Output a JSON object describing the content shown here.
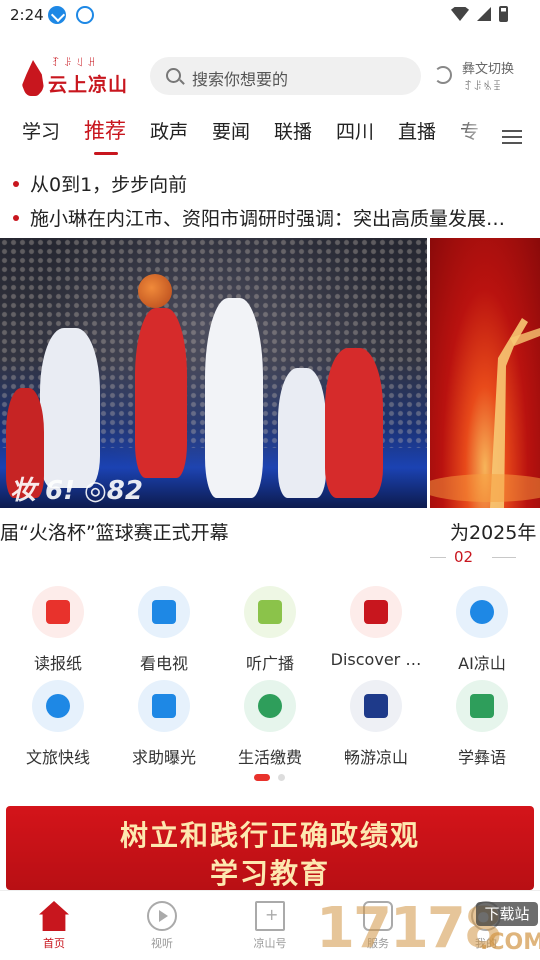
{
  "status_bar": {
    "time": "2:24"
  },
  "header": {
    "logo_text": "云上凉山",
    "logo_yi": "ꆈꌠꆹꃅ",
    "search_placeholder": "搜索你想要的",
    "switch_label": "彝文切换",
    "switch_label_yi": "ꆈꌠꁱꀨ"
  },
  "tabs": [
    {
      "label": "学习"
    },
    {
      "label": "推荐",
      "active": true
    },
    {
      "label": "政声"
    },
    {
      "label": "要闻"
    },
    {
      "label": "联播"
    },
    {
      "label": "四川"
    },
    {
      "label": "直播"
    },
    {
      "label": "专"
    }
  ],
  "headlines": [
    "从0到1，步步向前",
    "施小琳在内江市、资阳市调研时强调：突出高质量发展…"
  ],
  "carousel": {
    "floor_text": "妆 6! ◎82",
    "main_caption": "届“火洛杯”篮球赛正式开幕",
    "next_caption": "为2025年",
    "page_number": "02"
  },
  "services": [
    {
      "label": "读报纸",
      "icon": "newspaper-icon",
      "color": "#e8322c",
      "bg": "#fdecea"
    },
    {
      "label": "看电视",
      "icon": "tv-icon",
      "color": "#1e88e5",
      "bg": "#e6f1fc"
    },
    {
      "label": "听广播",
      "icon": "radio-icon",
      "color": "#8bc34a",
      "bg": "#eef7e4"
    },
    {
      "label": "Discover …",
      "icon": "discover-icon",
      "color": "#c8161e",
      "bg": "#fdecea"
    },
    {
      "label": "AI凉山",
      "icon": "robot-icon",
      "color": "#1e88e5",
      "bg": "#e6f1fc"
    },
    {
      "label": "文旅快线",
      "icon": "plane-icon",
      "color": "#1e88e5",
      "bg": "#e6f1fc"
    },
    {
      "label": "求助曝光",
      "icon": "report-icon",
      "color": "#1e88e5",
      "bg": "#e6f1fc"
    },
    {
      "label": "生活缴费",
      "icon": "payment-icon",
      "color": "#2e9e5b",
      "bg": "#e6f5ec"
    },
    {
      "label": "畅游凉山",
      "icon": "travel-icon",
      "color": "#1e3a8a",
      "bg": "#eef0f5"
    },
    {
      "label": "学彝语",
      "icon": "book-icon",
      "color": "#2e9e5b",
      "bg": "#e6f5ec"
    }
  ],
  "banner": {
    "line1": "树立和践行正确政绩观",
    "line2": "学习教育"
  },
  "bottom_nav": [
    {
      "label": "首页",
      "icon": "home-icon",
      "active": true
    },
    {
      "label": "视听",
      "icon": "play-icon"
    },
    {
      "label": "凉山号",
      "icon": "bookmark-icon"
    },
    {
      "label": "服务",
      "icon": "service-icon"
    },
    {
      "label": "我的",
      "icon": "user-icon"
    }
  ],
  "watermark": {
    "number": "17178",
    "tag": "下载站",
    "domain": ".COM"
  },
  "colors": {
    "brand": "#c8161e",
    "accent": "#e8322c"
  }
}
